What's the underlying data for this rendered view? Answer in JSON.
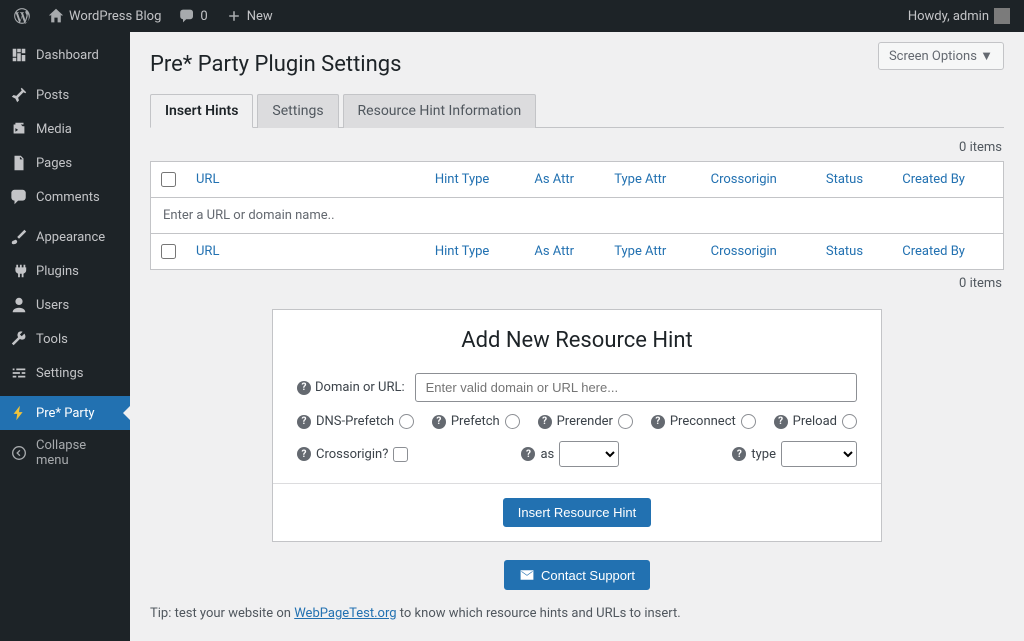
{
  "adminbar": {
    "site_title": "WordPress Blog",
    "comment_count": "0",
    "new_label": "New",
    "howdy": "Howdy, admin"
  },
  "sidebar": {
    "items": [
      {
        "label": "Dashboard"
      },
      {
        "label": "Posts"
      },
      {
        "label": "Media"
      },
      {
        "label": "Pages"
      },
      {
        "label": "Comments"
      },
      {
        "label": "Appearance"
      },
      {
        "label": "Plugins"
      },
      {
        "label": "Users"
      },
      {
        "label": "Tools"
      },
      {
        "label": "Settings"
      },
      {
        "label": "Pre* Party"
      },
      {
        "label": "Collapse menu"
      }
    ]
  },
  "screen_options_label": "Screen Options",
  "page_title": "Pre* Party Plugin Settings",
  "tabs": [
    {
      "label": "Insert Hints"
    },
    {
      "label": "Settings"
    },
    {
      "label": "Resource Hint Information"
    }
  ],
  "items_count": "0 items",
  "table": {
    "cols": {
      "url": "URL",
      "hint_type": "Hint Type",
      "as_attr": "As Attr",
      "type_attr": "Type Attr",
      "crossorigin": "Crossorigin",
      "status": "Status",
      "created_by": "Created By"
    },
    "empty_text": "Enter a URL or domain name.."
  },
  "form": {
    "heading": "Add New Resource Hint",
    "domain_label": "Domain or URL:",
    "domain_placeholder": "Enter valid domain or URL here...",
    "opts": {
      "dns_prefetch": "DNS-Prefetch",
      "prefetch": "Prefetch",
      "prerender": "Prerender",
      "preconnect": "Preconnect",
      "preload": "Preload"
    },
    "crossorigin_label": "Crossorigin?",
    "as_label": "as",
    "type_label": "type",
    "submit_label": "Insert Resource Hint"
  },
  "contact_label": "Contact Support",
  "tip": {
    "pre": "Tip: test your website on ",
    "link": "WebPageTest.org",
    "post": " to know which resource hints and URLs to insert."
  }
}
